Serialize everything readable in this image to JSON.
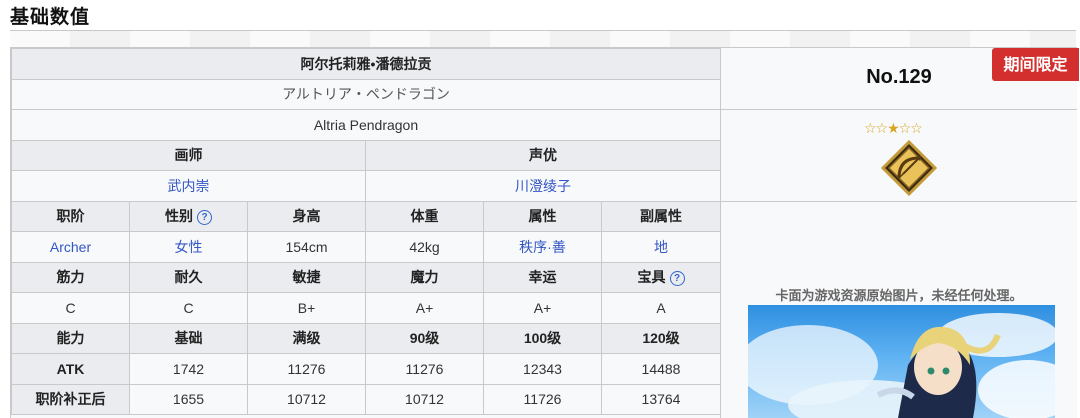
{
  "section": {
    "title": "基础数值"
  },
  "servant": {
    "name_cn": "阿尔托莉雅•潘德拉贡",
    "name_jp": "アルトリア・ペンドラゴン",
    "name_en": "Altria Pendragon",
    "illustrator_label": "画师",
    "voice_label": "声优",
    "illustrator": "武内崇",
    "voice": "川澄绫子"
  },
  "attr_headers": [
    "职阶",
    "性别",
    "身高",
    "体重",
    "属性",
    "副属性"
  ],
  "attr_values": [
    "Archer",
    "女性",
    "154cm",
    "42kg",
    "秩序·善",
    "地"
  ],
  "param_headers": [
    "筋力",
    "耐久",
    "敏捷",
    "魔力",
    "幸运",
    "宝具"
  ],
  "param_values": [
    "C",
    "C",
    "B+",
    "A+",
    "A+",
    "A"
  ],
  "stat_headers": [
    "能力",
    "基础",
    "满级",
    "90级",
    "100级",
    "120级"
  ],
  "atk_row": [
    "ATK",
    "1742",
    "11276",
    "11276",
    "12343",
    "14488"
  ],
  "atk2_row": [
    "职阶补正后",
    "1655",
    "10712",
    "10712",
    "11726",
    "13764"
  ],
  "help_glyph": "?",
  "side": {
    "number": "No.129",
    "badge": "期间限定",
    "stars": "☆☆★☆☆",
    "image_note": "卡面为游戏资源原始图片，未经任何处理。"
  },
  "colors": {
    "badge_bg": "#d32f2f",
    "link": "#3356c4",
    "header_bg": "#eaecf0"
  }
}
